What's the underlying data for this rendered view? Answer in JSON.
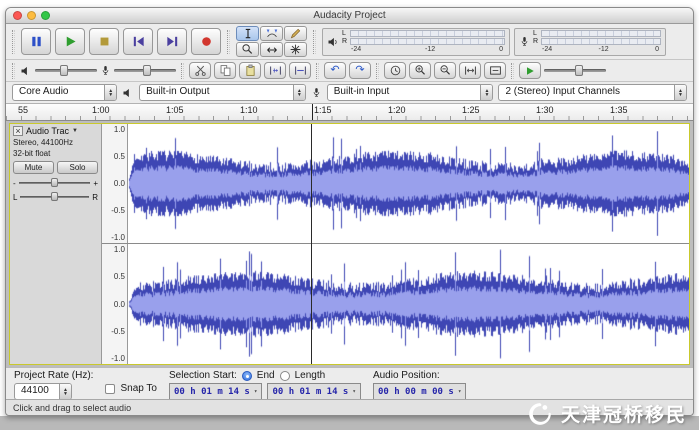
{
  "colors": {
    "waveform_peak": "#3e46b4",
    "waveform_rms": "#99a0ec",
    "waveform_bg": "#ffffff",
    "cursor": "#2a2a2a",
    "track_focus_border": "#c9c92c",
    "record_red": "#d2372e",
    "play_green": "#2f9e2f",
    "pause_blue": "#2d50c8",
    "stop_yellow": "#b39a3a",
    "skip_purple": "#4a3f9f"
  },
  "window": {
    "title": "Audacity Project"
  },
  "icons": {
    "combo_up": "▲",
    "combo_down": "▼",
    "track_dropdown": "▼",
    "close": "×",
    "undo": "↶",
    "redo": "↷",
    "multi_tool": "∗",
    "timefield_arrow": "▾"
  },
  "meters": {
    "playback": {
      "l": "L",
      "r": "R",
      "scale": [
        "-24",
        "-12",
        "0"
      ]
    },
    "recording": {
      "l": "L",
      "r": "R",
      "scale": [
        "-24",
        "-12",
        "0"
      ]
    }
  },
  "device_bar": {
    "host": "Core Audio",
    "output": "Built-in Output",
    "input": "Built-in Input",
    "channels": "2 (Stereo) Input Channels"
  },
  "timeline": {
    "labels": [
      "55",
      "1:00",
      "1:05",
      "1:10",
      "1:15",
      "1:20",
      "1:25",
      "1:30",
      "1:35"
    ]
  },
  "track": {
    "name": "Audio Trac",
    "format_line1": "Stereo, 44100Hz",
    "format_line2": "32-bit float",
    "mute": "Mute",
    "solo": "Solo",
    "gain_minus": "-",
    "gain_plus": "+",
    "pan_left": "L",
    "pan_right": "R",
    "scale": [
      "1.0",
      "0.5",
      "0.0",
      "-0.5",
      "-1.0"
    ]
  },
  "waveform": {
    "cursor_fraction": 0.325
  },
  "bottom_bar": {
    "project_rate_label": "Project Rate (Hz):",
    "project_rate_value": "44100",
    "snap_label": "Snap To",
    "selection_start_label": "Selection Start:",
    "radio_end": "End",
    "radio_length": "Length",
    "selection_start_value": "00 h 01 m 14 s",
    "selection_end_value": "00 h 01 m 14 s",
    "audio_position_label": "Audio Position:",
    "audio_position_value": "00 h 00 m 00 s"
  },
  "status_bar": {
    "message": "Click and drag to select audio"
  },
  "watermark": {
    "text": "天津冠桥移民"
  }
}
